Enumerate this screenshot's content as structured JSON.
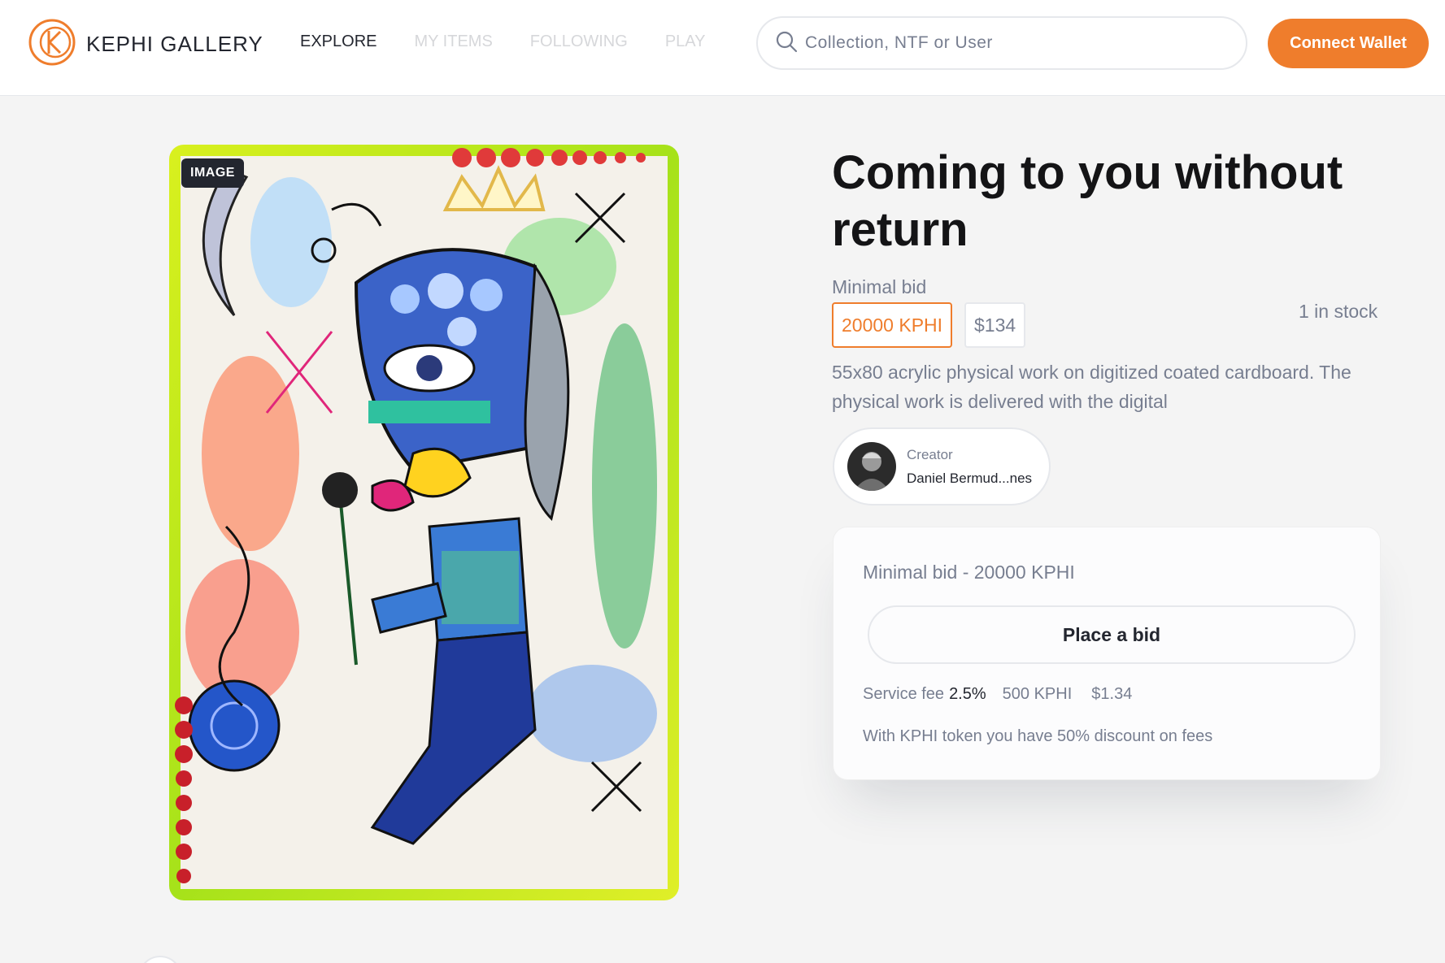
{
  "header": {
    "brand": "KEPHI GALLERY",
    "nav": [
      {
        "label": "EXPLORE",
        "active": true
      },
      {
        "label": "MY ITEMS",
        "active": false
      },
      {
        "label": "FOLLOWING",
        "active": false
      },
      {
        "label": "PLAY",
        "active": false
      }
    ],
    "search_placeholder": "Collection, NTF or User",
    "connect_label": "Connect Wallet"
  },
  "item": {
    "media_type": "IMAGE",
    "title": "Coming to you without return",
    "min_bid_label": "Minimal bid",
    "price_kphi": "20000 KPHI",
    "price_usd": "$134",
    "stock": "1 in stock",
    "description": "55x80 acrylic physical work on digitized coated cardboard. The physical work is delivered with the digital",
    "creator": {
      "role": "Creator",
      "name": "Daniel Bermud...nes"
    }
  },
  "bid_card": {
    "min_bid_text": "Minimal bid - 20000 KPHI",
    "place_bid_label": "Place a bid",
    "service_fee_label": "Service fee",
    "service_fee_pct": "2.5%",
    "fee_kphi": "500 KPHI",
    "fee_usd": "$1.34",
    "discount_note": "With KPHI token you have 50% discount on fees"
  },
  "colors": {
    "accent": "#ef7d2c",
    "text_primary": "#141416",
    "text_secondary": "#777e90",
    "border": "#e6e8ec"
  },
  "icons": {
    "logo": "kephi-logo-icon",
    "search": "search-icon"
  }
}
